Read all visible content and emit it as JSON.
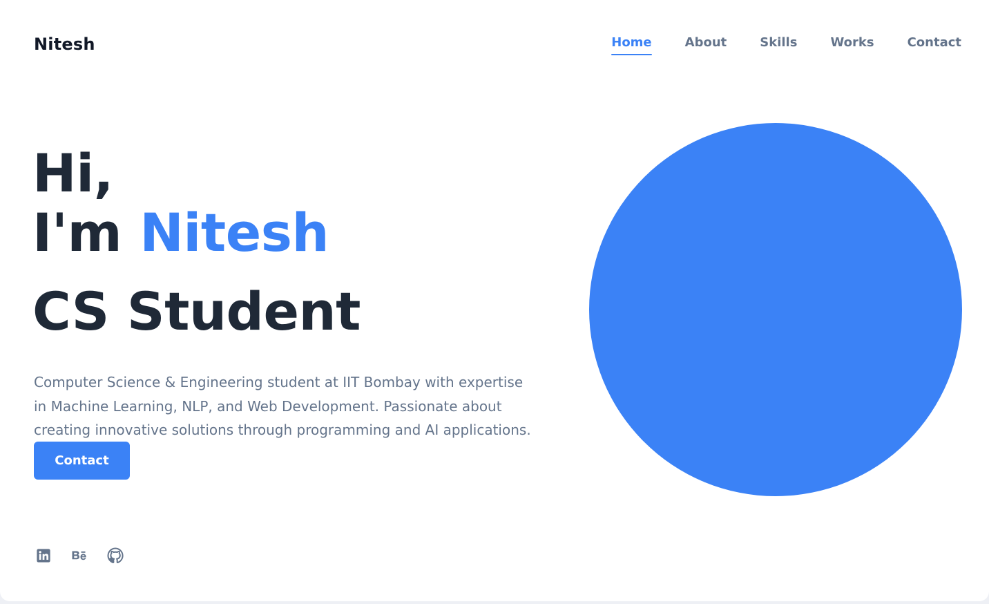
{
  "header": {
    "logo": "Nitesh",
    "nav": [
      {
        "label": "Home",
        "active": true
      },
      {
        "label": "About",
        "active": false
      },
      {
        "label": "Skills",
        "active": false
      },
      {
        "label": "Works",
        "active": false
      },
      {
        "label": "Contact",
        "active": false
      }
    ]
  },
  "hero": {
    "greeting": "Hi,",
    "intro_prefix": "I'm ",
    "name": "Nitesh",
    "role": "CS Student",
    "description": "Computer Science & Engineering student at IIT Bombay with expertise in Machine Learning, NLP, and Web Development. Passionate about creating innovative solutions through programming and AI applications.",
    "button_label": "Contact"
  },
  "socials": [
    {
      "icon": "linkedin-icon"
    },
    {
      "icon": "behance-icon"
    },
    {
      "icon": "github-icon"
    }
  ],
  "colors": {
    "accent": "#3b82f6",
    "heading": "#1f2937",
    "muted": "#64748b",
    "background": "#ffffff"
  }
}
